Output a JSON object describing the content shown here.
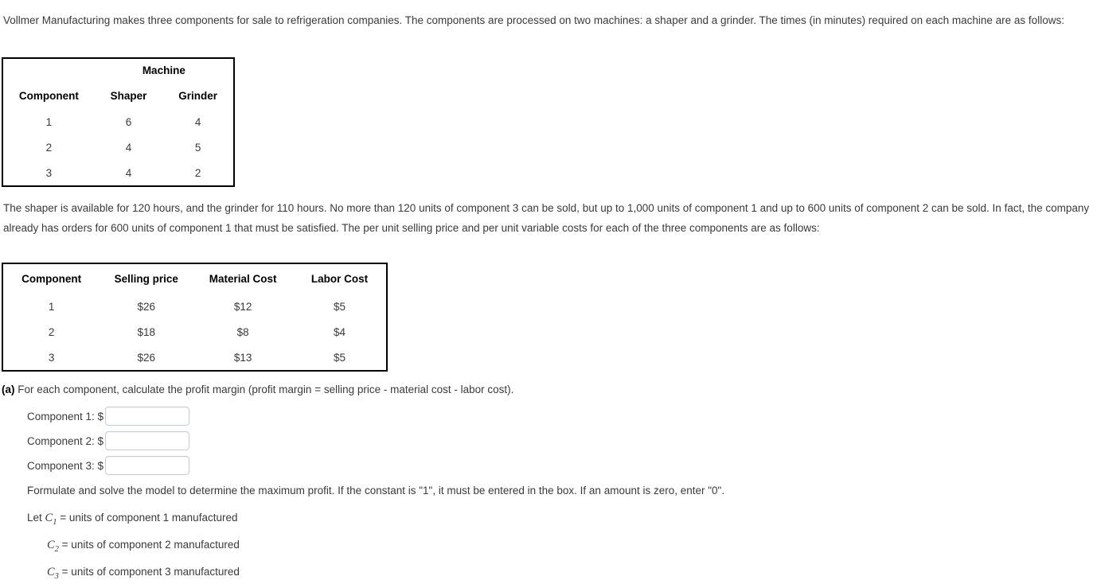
{
  "intro_paragraph": "Vollmer Manufacturing makes three components for sale to refrigeration companies. The components are processed on two machines: a shaper and a grinder. The times (in minutes) required on each machine are as follows:",
  "machine_table": {
    "span_header": "Machine",
    "headers": [
      "Component",
      "Shaper",
      "Grinder"
    ],
    "rows": [
      [
        "1",
        "6",
        "4"
      ],
      [
        "2",
        "4",
        "5"
      ],
      [
        "3",
        "4",
        "2"
      ]
    ]
  },
  "second_paragraph": "The shaper is available for 120 hours, and the grinder for 110 hours. No more than 120 units of component 3 can be sold, but up to 1,000 units of component 1 and up to 600 units of component 2 can be sold. In fact, the company already has orders for 600 units of component 1 that must be satisfied. The per unit selling price and per unit variable costs for each of the three components are as follows:",
  "cost_table": {
    "headers": [
      "Component",
      "Selling price",
      "Material Cost",
      "Labor Cost"
    ],
    "rows": [
      [
        "1",
        "$26",
        "$12",
        "$5"
      ],
      [
        "2",
        "$18",
        "$8",
        "$4"
      ],
      [
        "3",
        "$26",
        "$13",
        "$5"
      ]
    ]
  },
  "part_a": {
    "label": "(a)",
    "question": "For each component, calculate the profit margin (profit margin = selling price - material cost - labor cost).",
    "answers": [
      {
        "label": "Component 1: $",
        "value": "",
        "placeholder": ""
      },
      {
        "label": "Component 2: $",
        "value": "",
        "placeholder": ""
      },
      {
        "label": "Component 3: $",
        "value": "",
        "placeholder": ""
      }
    ],
    "formulate_note": "Formulate and solve the model to determine the maximum profit. If the constant is \"1\", it must be entered in the box. If an amount is zero, enter \"0\".",
    "variable_definitions": [
      {
        "prefix": "Let ",
        "var": "C",
        "sub": "1",
        "rest": " = units of component 1 manufactured"
      },
      {
        "prefix": "",
        "var": "C",
        "sub": "2",
        "rest": " = units of component 2 manufactured"
      },
      {
        "prefix": "",
        "var": "C",
        "sub": "3",
        "rest": " = units of component 3 manufactured"
      }
    ]
  },
  "colors": {
    "body_text": "#3a3a3a",
    "header_text": "#000000",
    "table_border": "#000000",
    "input_border": "#c9cdd1",
    "background": "#ffffff"
  }
}
